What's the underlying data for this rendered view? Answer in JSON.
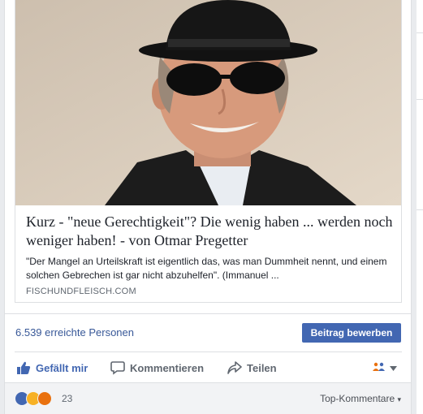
{
  "link": {
    "title": "Kurz - \"neue Gerechtigkeit\"? Die wenig haben ... werden noch weniger haben! - von Otmar Pregetter",
    "description": "\"Der Mangel an Urteilskraft ist eigentlich das, was man Dummheit nennt, und einem solchen Gebrechen ist gar nicht abzuhelfen\". (Immanuel ...",
    "domain": "FISCHUNDFLEISCH.COM"
  },
  "stats": {
    "reach": "6.539 erreichte Personen",
    "promote_label": "Beitrag bewerben"
  },
  "actions": {
    "like": "Gefällt mir",
    "comment": "Kommentieren",
    "share": "Teilen"
  },
  "reactions": {
    "count": "23",
    "sort_label": "Top-Kommentare",
    "colors": {
      "like": "#4267b2",
      "haha": "#f7b125",
      "angry": "#e9710f"
    }
  },
  "icons": [
    "thumbs-up-icon",
    "comment-icon",
    "share-icon",
    "audience-icon",
    "chevron-down-icon"
  ]
}
